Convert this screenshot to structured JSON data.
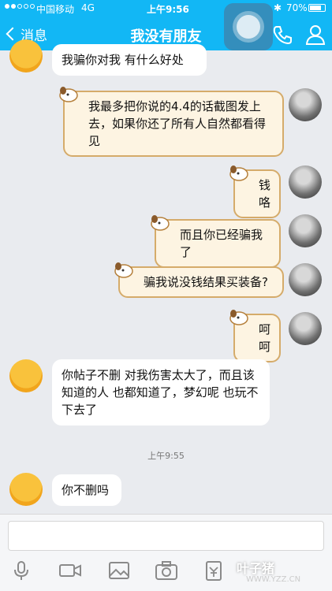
{
  "status_bar": {
    "carrier": "中国移动",
    "network": "4G",
    "time": "上午9:56",
    "battery": "70%"
  },
  "nav": {
    "back_label": "消息",
    "title": "我没有朋友"
  },
  "messages": [
    {
      "side": "left",
      "text": "我骗你对我  有什么好处"
    },
    {
      "side": "right",
      "text": "我最多把你说的4.4的话截图发上去，如果你还了所有人自然都看得见"
    },
    {
      "side": "right",
      "text": "钱咯"
    },
    {
      "side": "right",
      "text": "而且你已经骗我了"
    },
    {
      "side": "right",
      "text": "骗我说没钱结果买装备?"
    },
    {
      "side": "right",
      "text": "呵呵"
    },
    {
      "side": "left",
      "text": "你帖子不删 对我伤害太大了，而且该知道的人 也都知道了，梦幻呢 也玩不下去了"
    },
    {
      "side": "left",
      "text": "你不删吗"
    }
  ],
  "timestamp": "上午9:55",
  "watermark": {
    "title": "叶子猪",
    "url": "WWW.YZZ.CN"
  },
  "colors": {
    "accent": "#12b7f5",
    "background": "#e9ebef",
    "deco_bubble": "#fdf4e2"
  }
}
